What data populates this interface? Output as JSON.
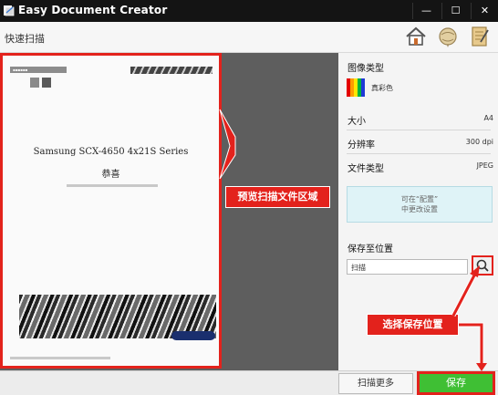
{
  "window": {
    "title": "Easy Document Creator",
    "minimize_glyph": "—",
    "maximize_glyph": "☐",
    "close_glyph": "✕"
  },
  "toolbar": {
    "mode_label": "快速扫描",
    "icons": [
      "home-icon",
      "help-globe-icon",
      "document-icon"
    ]
  },
  "preview": {
    "doc_title": "Samsung SCX-4650 4x21S Series",
    "doc_subtitle": "恭喜"
  },
  "annotations": {
    "preview_callout": "预览扫描文件区域",
    "save_location_callout": "选择保存位置"
  },
  "settings": {
    "image_type_label": "图像类型",
    "image_type_value": "真彩色",
    "size_label": "大小",
    "size_value": "A4",
    "resolution_label": "分辨率",
    "resolution_value": "300 dpi",
    "file_type_label": "文件类型",
    "file_type_value": "JPEG",
    "change_hint_line1": "可在“配置”",
    "change_hint_line2": "中更改设置",
    "save_to_label": "保存至位置",
    "save_to_value": "扫描"
  },
  "actions": {
    "scan_more_label": "扫描更多",
    "save_label": "保存"
  },
  "colors": {
    "callout_red": "#e3221c",
    "save_green": "#3fbf34",
    "titlebar_bg": "#141414",
    "workspace_gray": "#5e5e5e",
    "hint_box_bg": "#dff3f7"
  }
}
